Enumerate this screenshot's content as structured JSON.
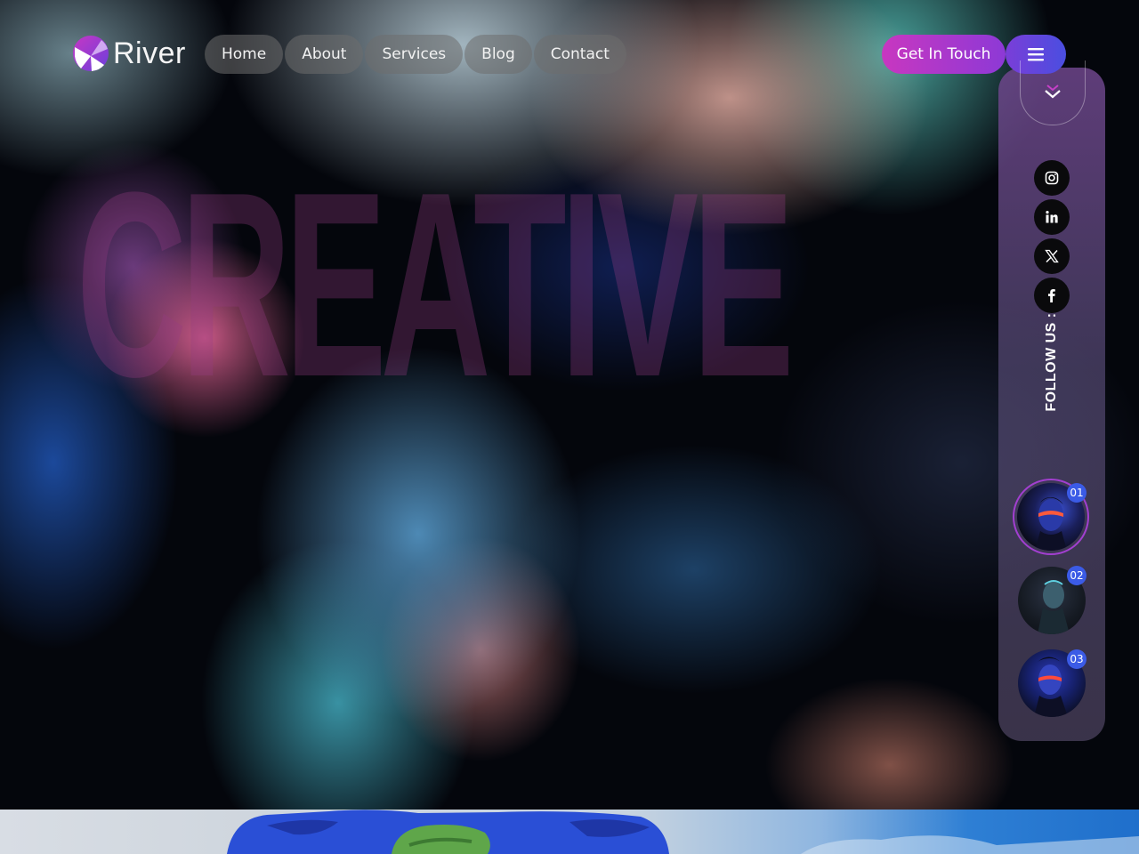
{
  "brand": {
    "name": "River"
  },
  "nav": {
    "items": [
      {
        "label": "Home"
      },
      {
        "label": "About"
      },
      {
        "label": "Services"
      },
      {
        "label": "Blog"
      },
      {
        "label": "Contact"
      }
    ]
  },
  "header": {
    "cta_label": "Get In Touch",
    "menu_icon": "hamburger-icon"
  },
  "hero": {
    "headline": "CREATIVE"
  },
  "sidebar": {
    "scroll_icon": "chevron-down-icon",
    "social": [
      {
        "icon": "instagram-icon"
      },
      {
        "icon": "linkedin-icon"
      },
      {
        "icon": "x-twitter-icon"
      },
      {
        "icon": "facebook-icon"
      }
    ],
    "follow_label": "FOLLOW US :",
    "slides": [
      {
        "number": "01"
      },
      {
        "number": "02"
      },
      {
        "number": "03"
      }
    ]
  },
  "colors": {
    "accent_pink": "#c837c0",
    "accent_purple": "#8d39d6",
    "accent_blue": "#4a4ee0",
    "badge_blue": "#3b5be6"
  }
}
